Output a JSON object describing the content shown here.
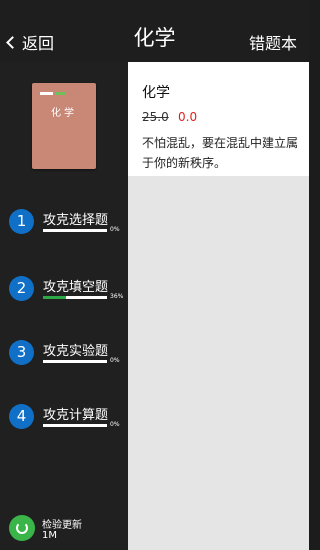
{
  "header": {
    "back_label": "返回",
    "title": "化学",
    "wrong_book_label": "错题本"
  },
  "book": {
    "cover_title": "化学"
  },
  "modules": [
    {
      "number": "1",
      "label": "攻克选择题",
      "progress": 0,
      "progress_text": "0%"
    },
    {
      "number": "2",
      "label": "攻克填空题",
      "progress": 36,
      "progress_text": "36%"
    },
    {
      "number": "3",
      "label": "攻克实验题",
      "progress": 0,
      "progress_text": "0%"
    },
    {
      "number": "4",
      "label": "攻克计算题",
      "progress": 0,
      "progress_text": "0%"
    }
  ],
  "update": {
    "label": "检验更新",
    "size": "1M"
  },
  "detail": {
    "title": "化学",
    "price_old": "25.0",
    "price_new": "0.0",
    "description": "不怕混乱，要在混乱中建立属于你的新秩序。"
  },
  "colors": {
    "accent_blue": "#1070c8",
    "progress_green": "#2ea846",
    "price_red": "#e02020"
  }
}
